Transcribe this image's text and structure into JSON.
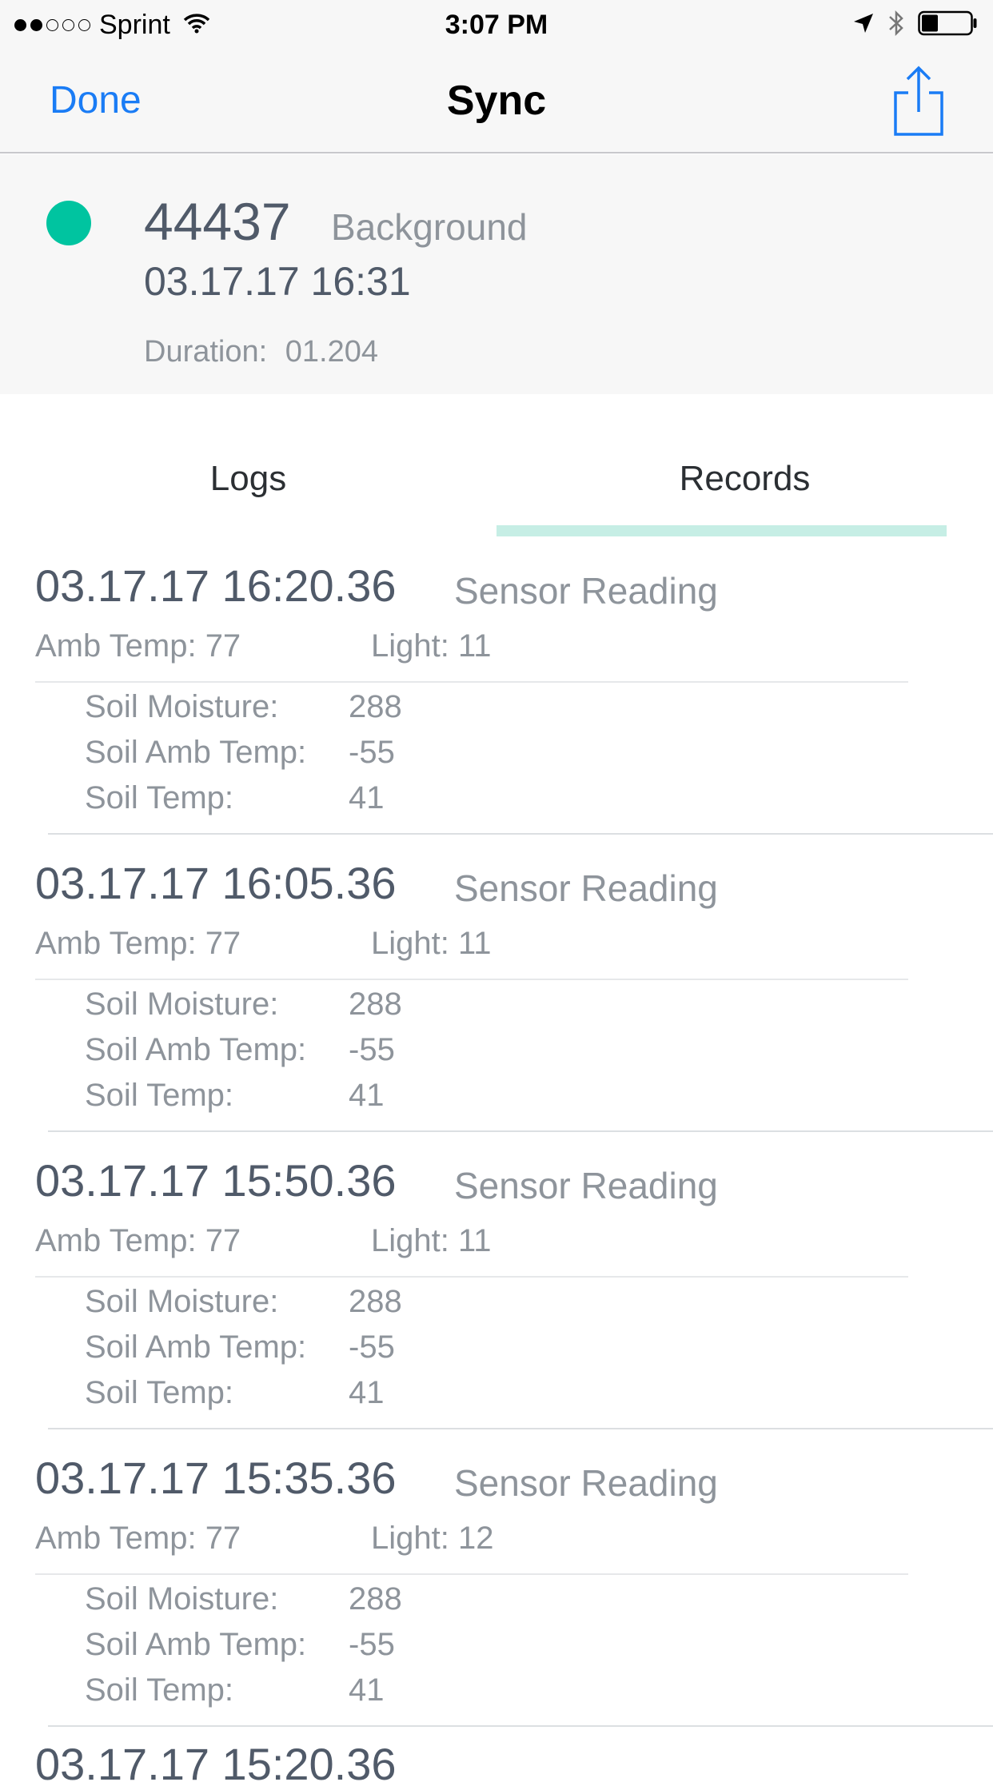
{
  "status_bar": {
    "carrier": "Sprint",
    "time": "3:07 PM",
    "signal_icon": "signal-dots",
    "wifi_icon": "wifi-icon",
    "location_icon": "location-arrow-icon",
    "bluetooth_icon": "bluetooth-icon",
    "battery_icon": "battery-icon",
    "battery_level": 0.3
  },
  "nav": {
    "done_label": "Done",
    "title": "Sync",
    "share_icon": "share-icon",
    "accent_color": "#1a7cf5"
  },
  "sync": {
    "id": "44437",
    "type": "Background",
    "date": "03.17.17 16:31",
    "duration_label": "Duration:",
    "duration_value": "01.204",
    "status_color": "#00c4a0"
  },
  "tabs": {
    "logs": "Logs",
    "records": "Records",
    "selected": "records"
  },
  "labels": {
    "amb_temp": "Amb Temp:",
    "light": "Light:",
    "soil_moisture": "Soil Moisture:",
    "soil_amb_temp": "Soil Amb Temp:",
    "soil_temp": "Soil Temp:"
  },
  "records": [
    {
      "time": "03.17.17 16:20.36",
      "type": "Sensor Reading",
      "amb_temp": "77",
      "light": "11",
      "soil_moisture": "288",
      "soil_amb_temp": "-55",
      "soil_temp": "41"
    },
    {
      "time": "03.17.17 16:05.36",
      "type": "Sensor Reading",
      "amb_temp": "77",
      "light": "11",
      "soil_moisture": "288",
      "soil_amb_temp": "-55",
      "soil_temp": "41"
    },
    {
      "time": "03.17.17 15:50.36",
      "type": "Sensor Reading",
      "amb_temp": "77",
      "light": "11",
      "soil_moisture": "288",
      "soil_amb_temp": "-55",
      "soil_temp": "41"
    },
    {
      "time": "03.17.17 15:35.36",
      "type": "Sensor Reading",
      "amb_temp": "77",
      "light": "12",
      "soil_moisture": "288",
      "soil_amb_temp": "-55",
      "soil_temp": "41"
    }
  ],
  "peek_record_time": "03.17.17 15:20.36"
}
